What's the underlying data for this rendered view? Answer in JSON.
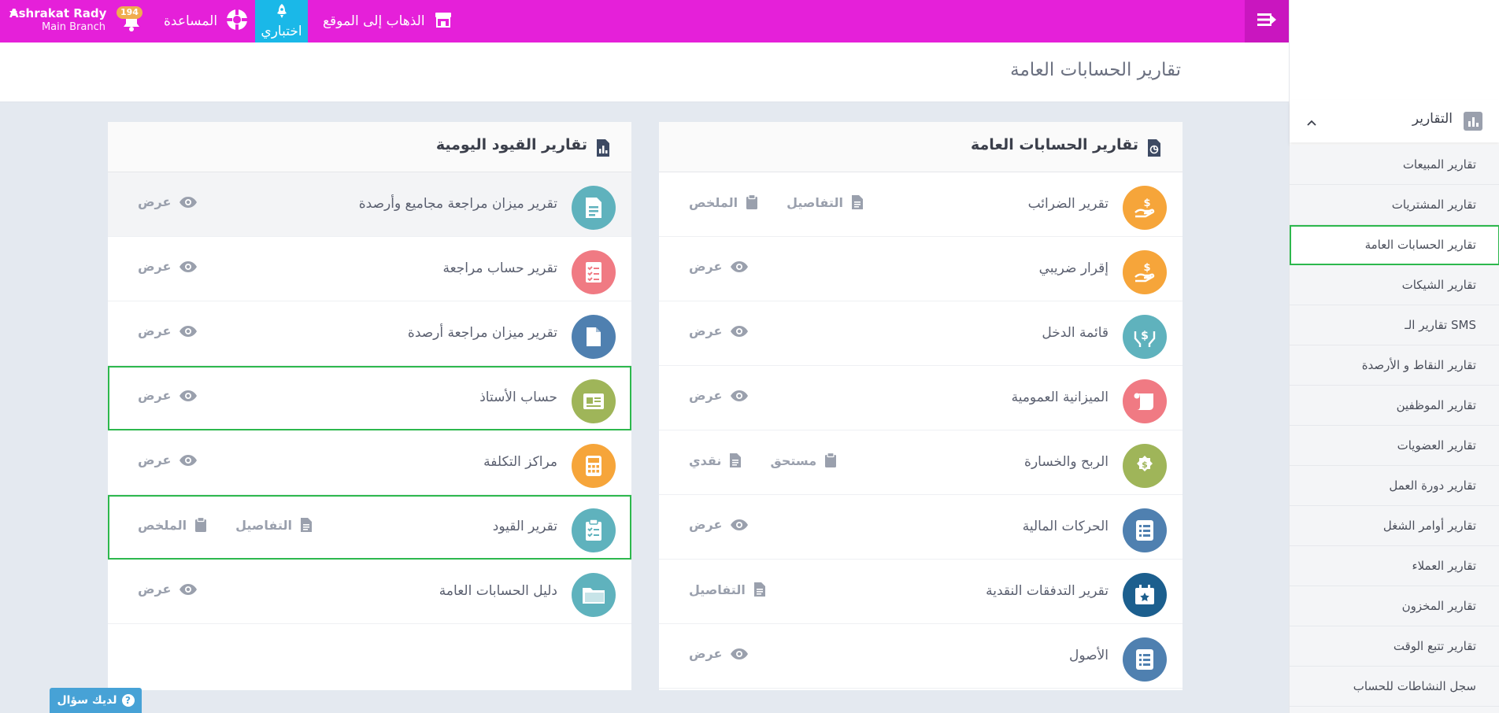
{
  "topbar": {
    "user_name": "Ashrakat Rady",
    "branch": "Main Branch",
    "notification_count": "194",
    "help_label": "المساعدة",
    "test_label": "اختباري",
    "go_to_site_label": "الذهاب إلى الموقع",
    "bar_color": "#e520d9",
    "test_color": "#1ab8e8"
  },
  "page_title": "تقارير الحسابات العامة",
  "general_panel": {
    "title": "تقارير الحسابات العامة",
    "rows": [
      {
        "label": "تقرير الضرائب",
        "icon": "hand-dollar-icon",
        "color": "#f6a53a",
        "actions": [
          {
            "label": "التفاصيل",
            "icon": "document-icon"
          },
          {
            "label": "الملخص",
            "icon": "clipboard-icon"
          }
        ]
      },
      {
        "label": "إقرار ضريبي",
        "icon": "hand-dollar-icon",
        "color": "#f6a53a",
        "actions": [
          {
            "label": "عرض",
            "icon": "eye-icon"
          }
        ]
      },
      {
        "label": "قائمة الدخل",
        "icon": "hands-dollar-icon",
        "color": "#5fb2bd",
        "actions": [
          {
            "label": "عرض",
            "icon": "eye-icon"
          }
        ]
      },
      {
        "label": "الميزانية العمومية",
        "icon": "scroll-icon",
        "color": "#f07a83",
        "actions": [
          {
            "label": "عرض",
            "icon": "eye-icon"
          }
        ]
      },
      {
        "label": "الربح والخسارة",
        "icon": "money-badge-icon",
        "color": "#9fb559",
        "actions": [
          {
            "label": "مستحق",
            "icon": "clipboard-icon"
          },
          {
            "label": "نقدي",
            "icon": "document-icon"
          }
        ]
      },
      {
        "label": "الحركات المالية",
        "icon": "list-icon",
        "color": "#4f80b0",
        "actions": [
          {
            "label": "عرض",
            "icon": "eye-icon"
          }
        ]
      },
      {
        "label": "تقرير التدفقات النقدية",
        "icon": "calendar-star-icon",
        "color": "#1c5f8e",
        "actions": [
          {
            "label": "التفاصيل",
            "icon": "document-icon"
          }
        ]
      },
      {
        "label": "الأصول",
        "icon": "list-icon",
        "color": "#4f80b0",
        "actions": [
          {
            "label": "عرض",
            "icon": "eye-icon"
          }
        ]
      }
    ]
  },
  "journal_panel": {
    "title": "تقارير القيود اليومية",
    "rows": [
      {
        "label": "تقرير ميزان مراجعة مجاميع وأرصدة",
        "icon": "document-lines-icon",
        "color": "#5fb2bd",
        "actions": [
          {
            "label": "عرض",
            "icon": "eye-icon"
          }
        ]
      },
      {
        "label": "تقرير حساب مراجعة",
        "icon": "checklist-icon",
        "color": "#f07a83",
        "actions": [
          {
            "label": "عرض",
            "icon": "eye-icon"
          }
        ]
      },
      {
        "label": "تقرير ميزان مراجعة أرصدة",
        "icon": "file-icon",
        "color": "#4f80b0",
        "actions": [
          {
            "label": "عرض",
            "icon": "eye-icon"
          }
        ]
      },
      {
        "label": "حساب الأستاذ",
        "icon": "id-card-icon",
        "color": "#9fb559",
        "actions": [
          {
            "label": "عرض",
            "icon": "eye-icon"
          }
        ]
      },
      {
        "label": "مراكز التكلفة",
        "icon": "calculator-icon",
        "color": "#f6a53a",
        "actions": [
          {
            "label": "عرض",
            "icon": "eye-icon"
          }
        ]
      },
      {
        "label": "تقرير القيود",
        "icon": "clipboard-check-icon",
        "color": "#5fb2bd",
        "actions": [
          {
            "label": "التفاصيل",
            "icon": "document-icon"
          },
          {
            "label": "الملخص",
            "icon": "clipboard-icon"
          }
        ]
      },
      {
        "label": "دليل الحسابات العامة",
        "icon": "folder-icon",
        "color": "#5fb2bd",
        "actions": [
          {
            "label": "عرض",
            "icon": "eye-icon"
          }
        ]
      }
    ]
  },
  "sidebar": {
    "section_title": "التقارير",
    "items": [
      "تقارير المبيعات",
      "تقارير المشتريات",
      "تقارير الحسابات العامة",
      "تقارير الشيكات",
      "تقارير الـ SMS",
      "تقارير النقاط و الأرصدة",
      "تقارير الموظفين",
      "تقارير العضويات",
      "تقارير دورة العمل",
      "تقارير أوامر الشغل",
      "تقارير العملاء",
      "تقارير المخزون",
      "تقارير تتبع الوقت",
      "سجل النشاطات للحساب"
    ]
  },
  "question_button": "لديك سؤال",
  "highlight_color": "#2db84d"
}
